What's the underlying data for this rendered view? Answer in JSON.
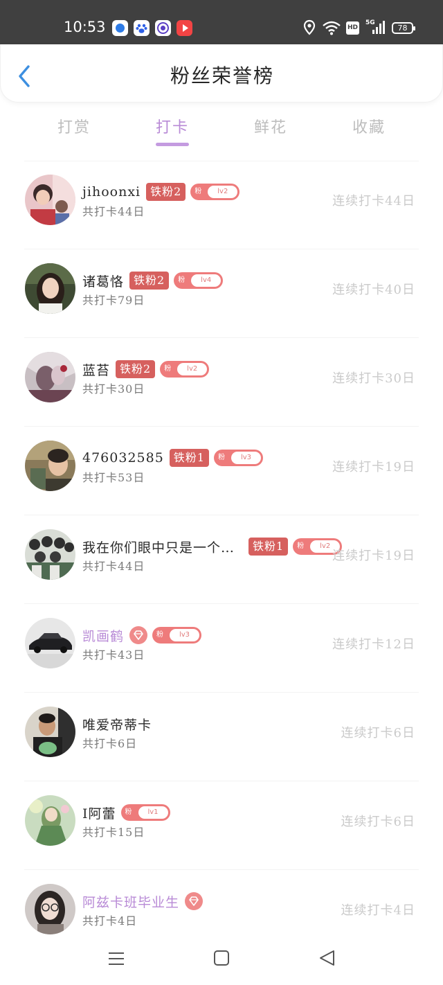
{
  "status_bar": {
    "time": "10:53",
    "hd": "HD",
    "network": "5G",
    "battery": "78",
    "apps": [
      "blue-circle-app-icon",
      "baidu-paw-icon",
      "purple-circle-app-icon",
      "red-play-app-icon"
    ]
  },
  "header": {
    "title": "粉丝荣誉榜",
    "back_icon": "chevron-left-icon"
  },
  "tabs": [
    {
      "label": "打赏",
      "active": false
    },
    {
      "label": "打卡",
      "active": true
    },
    {
      "label": "鲜花",
      "active": false
    },
    {
      "label": "收藏",
      "active": false
    }
  ],
  "rows": [
    {
      "name": "jihoonxi",
      "badge": "铁粉2",
      "fan_label": "粉",
      "level": "lv2",
      "total": "共打卡44日",
      "streak": "连续打卡44日",
      "purple": false
    },
    {
      "name": "诸葛恪",
      "badge": "铁粉2",
      "fan_label": "粉",
      "level": "lv4",
      "total": "共打卡79日",
      "streak": "连续打卡40日",
      "purple": false
    },
    {
      "name": "蓝苔",
      "badge": "铁粉2",
      "fan_label": "粉",
      "level": "lv2",
      "total": "共打卡30日",
      "streak": "连续打卡30日",
      "purple": false
    },
    {
      "name": "476032585",
      "badge": "铁粉1",
      "fan_label": "粉",
      "level": "lv3",
      "total": "共打卡53日",
      "streak": "连续打卡19日",
      "purple": false
    },
    {
      "name": "我在你们眼中只是一个…",
      "badge": "铁粉1",
      "fan_label": "粉",
      "level": "lv2",
      "total": "共打卡44日",
      "streak": "连续打卡19日",
      "purple": false
    },
    {
      "name": "凯画鹤",
      "badge": "",
      "fan_label": "粉",
      "level": "lv3",
      "total": "共打卡43日",
      "streak": "连续打卡12日",
      "purple": true
    },
    {
      "name": "唯爱帝蒂卡",
      "badge": "",
      "fan_label": "",
      "level": "",
      "total": "共打卡6日",
      "streak": "连续打卡6日",
      "purple": false
    },
    {
      "name": "I阿蕾",
      "badge": "",
      "fan_label": "粉",
      "level": "lv1",
      "total": "共打卡15日",
      "streak": "连续打卡6日",
      "purple": false
    },
    {
      "name": "阿兹卡班毕业生",
      "badge": "",
      "fan_label": "",
      "level": "",
      "total": "共打卡4日",
      "streak": "连续打卡4日",
      "purple": true
    }
  ],
  "navbar": {
    "menu_icon": "menu-icon",
    "home_icon": "square-home-icon",
    "back_icon": "triangle-back-icon"
  },
  "colors": {
    "accent_purple": "#b88ad6",
    "badge_red": "#d6605e",
    "pill_pink": "#ee7b7b",
    "status_bar": "#404040"
  }
}
